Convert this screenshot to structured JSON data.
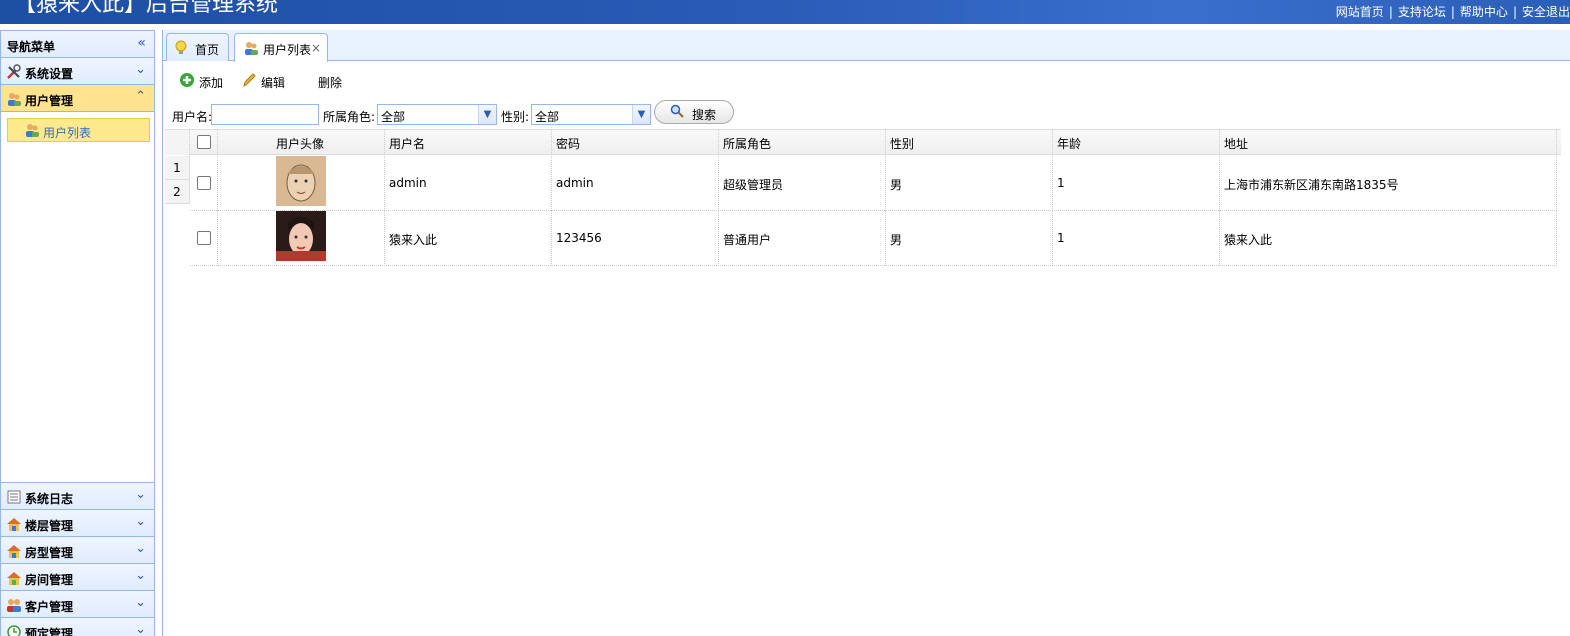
{
  "header": {
    "title": "【猿来入此】后台管理系统",
    "links": [
      "网站首页",
      "支持论坛",
      "帮助中心",
      "安全退出"
    ]
  },
  "sidebar": {
    "title": "导航菜单",
    "menus": [
      {
        "label": "系统设置",
        "icon": "wrench-icon"
      },
      {
        "label": "用户管理",
        "icon": "users-icon",
        "active": true,
        "children": [
          {
            "label": "用户列表",
            "icon": "users-icon"
          }
        ]
      },
      {
        "label": "系统日志",
        "icon": "log-icon"
      },
      {
        "label": "楼层管理",
        "icon": "house-icon"
      },
      {
        "label": "房型管理",
        "icon": "house-icon"
      },
      {
        "label": "房间管理",
        "icon": "house-icon"
      },
      {
        "label": "客户管理",
        "icon": "customer-icon"
      },
      {
        "label": "预定管理",
        "icon": "clock-icon"
      }
    ]
  },
  "tabs": [
    {
      "label": "首页",
      "icon": "bulb-icon"
    },
    {
      "label": "用户列表",
      "icon": "users-icon",
      "selected": true,
      "closable": "×"
    }
  ],
  "toolbar": {
    "add": "添加",
    "edit": "编辑",
    "delete": "删除"
  },
  "search": {
    "username_label": "用户名:",
    "username_value": "",
    "role_label": "所属角色:",
    "role_value": "全部",
    "sex_label": "性别:",
    "sex_value": "全部",
    "button": "搜索"
  },
  "grid": {
    "columns": [
      "用户头像",
      "用户名",
      "密码",
      "所属角色",
      "性别",
      "年龄",
      "地址"
    ],
    "row_numbers": [
      "1",
      "2"
    ],
    "rows": [
      {
        "username": "admin",
        "password": "admin",
        "role": "超级管理员",
        "sex": "男",
        "age": "1",
        "address": "上海市浦东新区浦东南路1835号"
      },
      {
        "username": "猿来入此",
        "password": "123456",
        "role": "普通用户",
        "sex": "男",
        "age": "1",
        "address": "猿来入此"
      }
    ]
  }
}
